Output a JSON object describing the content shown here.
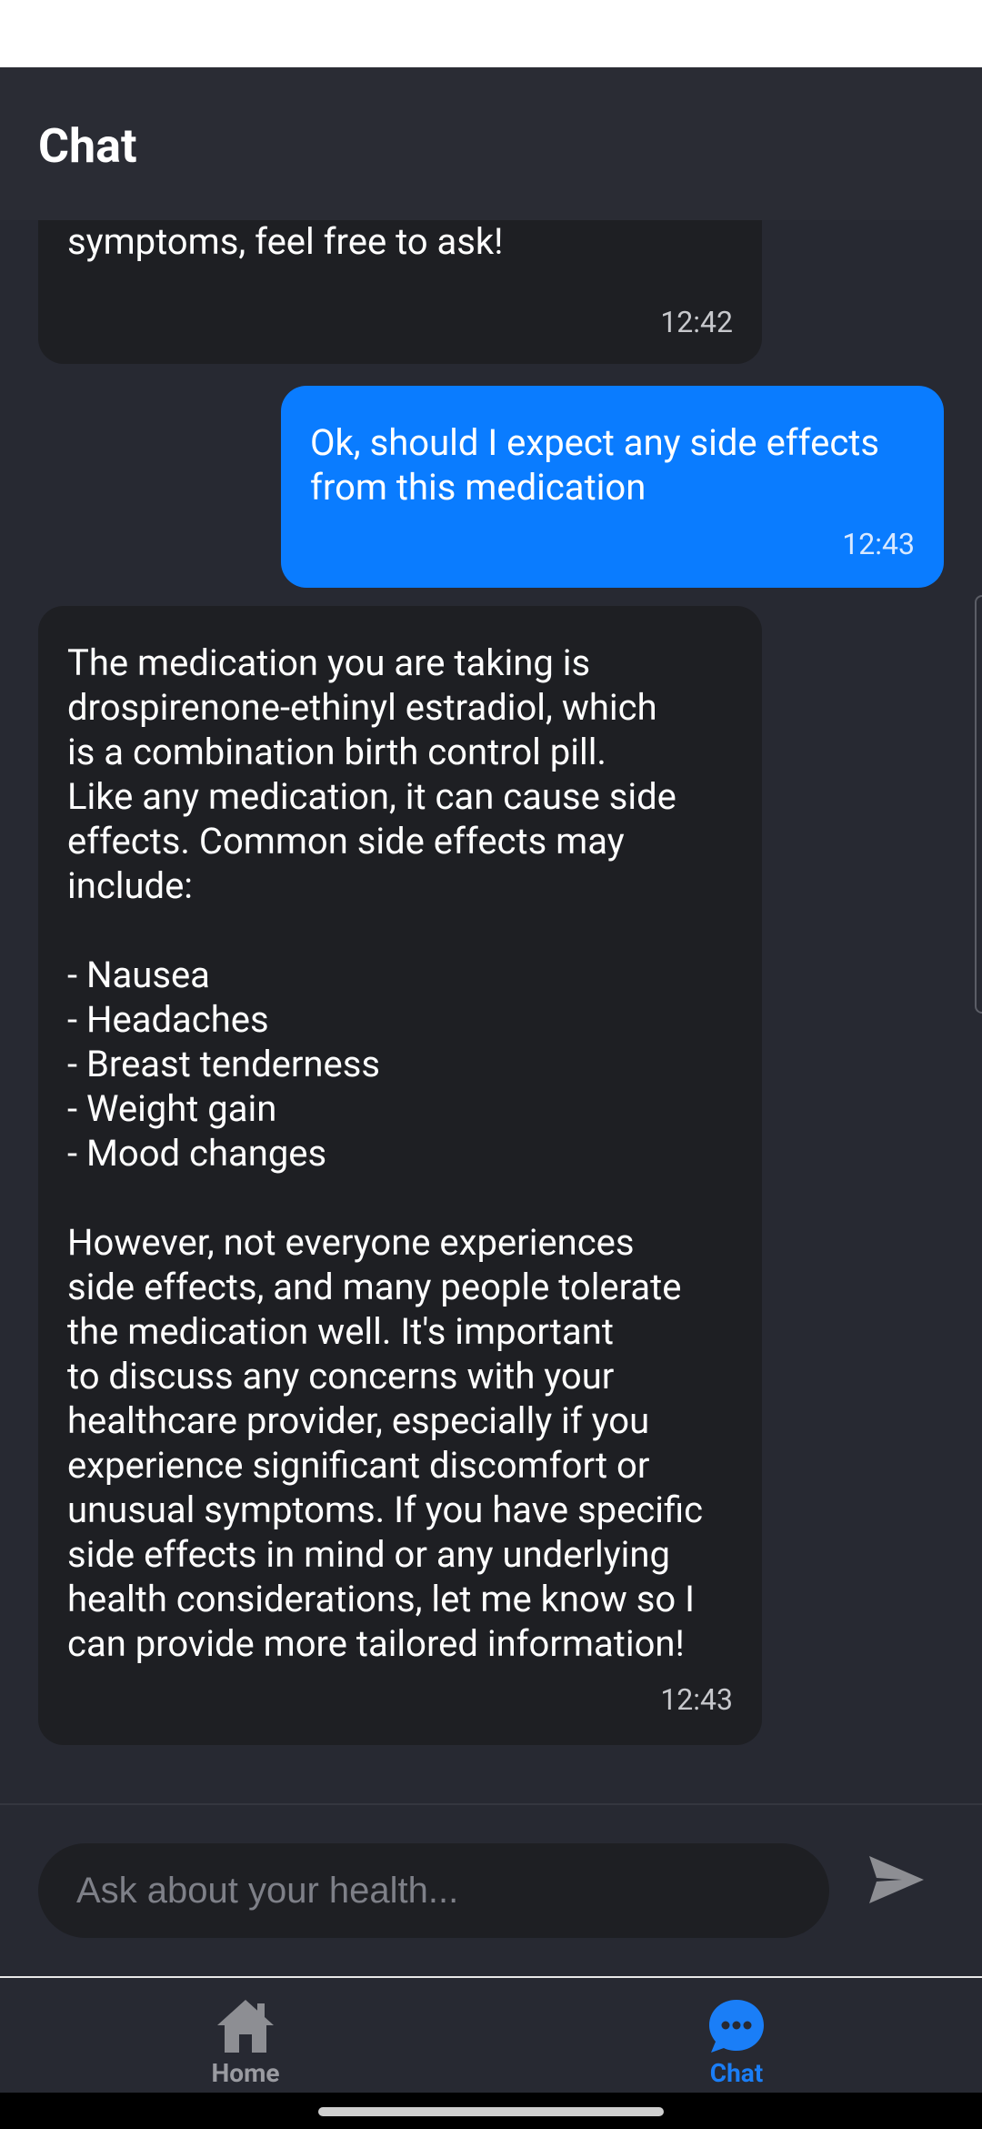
{
  "header": {
    "title": "Chat"
  },
  "messages": [
    {
      "role": "assistant",
      "text": "information regarding management of\nsymptoms, feel free to ask!",
      "time": "12:42"
    },
    {
      "role": "user",
      "text": "Ok, should I expect any side effects\nfrom this medication",
      "time": "12:43"
    },
    {
      "role": "assistant",
      "text": "The medication you are taking is\ndrospirenone-ethinyl estradiol, which\nis a combination birth control pill.\nLike any medication, it can cause side\neffects. Common side effects may\ninclude:\n\n- Nausea\n- Headaches\n- Breast tenderness\n- Weight gain\n- Mood changes\n\nHowever, not everyone experiences\nside effects, and many people tolerate\nthe medication well. It's important\nto discuss any concerns with your\nhealthcare provider, especially if you\nexperience significant discomfort or\nunusual symptoms. If you have specific\nside effects in mind or any underlying\nhealth considerations, let me know so I\ncan provide more tailored information!",
      "time": "12:43"
    }
  ],
  "input": {
    "placeholder": "Ask about your health...",
    "value": ""
  },
  "nav": [
    {
      "label": "Home",
      "icon": "home-icon",
      "active": false
    },
    {
      "label": "Chat",
      "icon": "chat-bubble-icon",
      "active": true
    }
  ],
  "colors": {
    "background": "#272932",
    "assistant_bubble": "#1e1f23",
    "user_bubble": "#0a7cff",
    "accent": "#1a7ef7"
  }
}
